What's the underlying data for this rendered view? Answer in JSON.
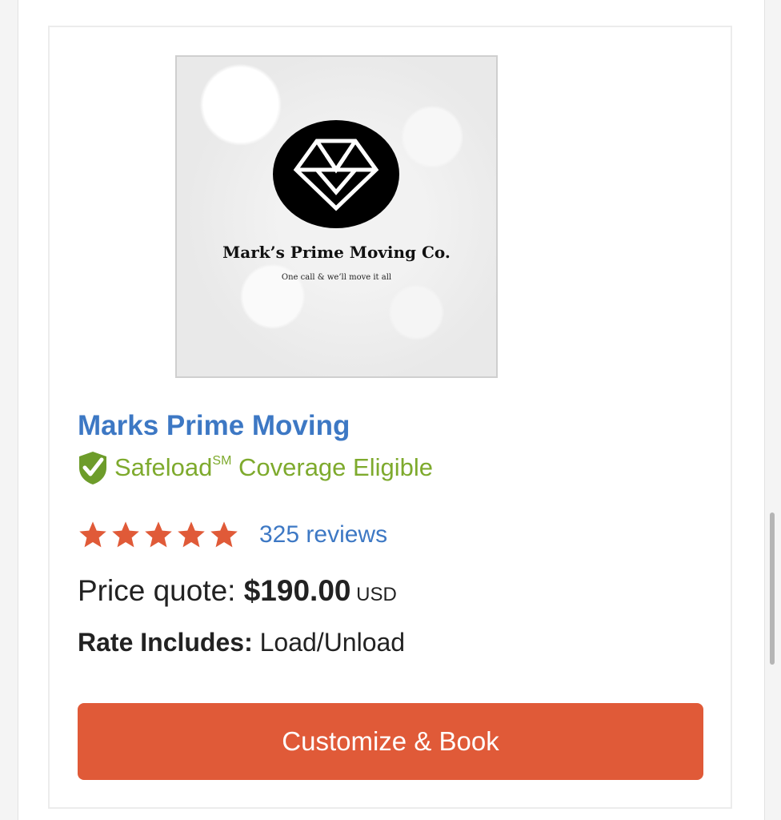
{
  "listing": {
    "logo": {
      "company_name": "Mark’s Prime Moving Co.",
      "tagline": "One call & we’ll move it all"
    },
    "title": "Marks Prime Moving",
    "coverage": {
      "label_prefix": "Safeload",
      "superscript": "SM",
      "label_suffix": " Coverage Eligible",
      "icon": "shield-check-icon",
      "color": "#7eaa2d"
    },
    "rating": {
      "stars": 5,
      "max_stars": 5,
      "reviews_text": "325 reviews",
      "star_color": "#e05a38"
    },
    "price": {
      "label": "Price quote: ",
      "amount": "$190.00",
      "currency": " USD"
    },
    "rate": {
      "label": "Rate Includes:",
      "value": " Load/Unload"
    },
    "book_button_label": "Customize & Book"
  },
  "colors": {
    "link": "#3d78c4",
    "accent": "#e05a38"
  }
}
